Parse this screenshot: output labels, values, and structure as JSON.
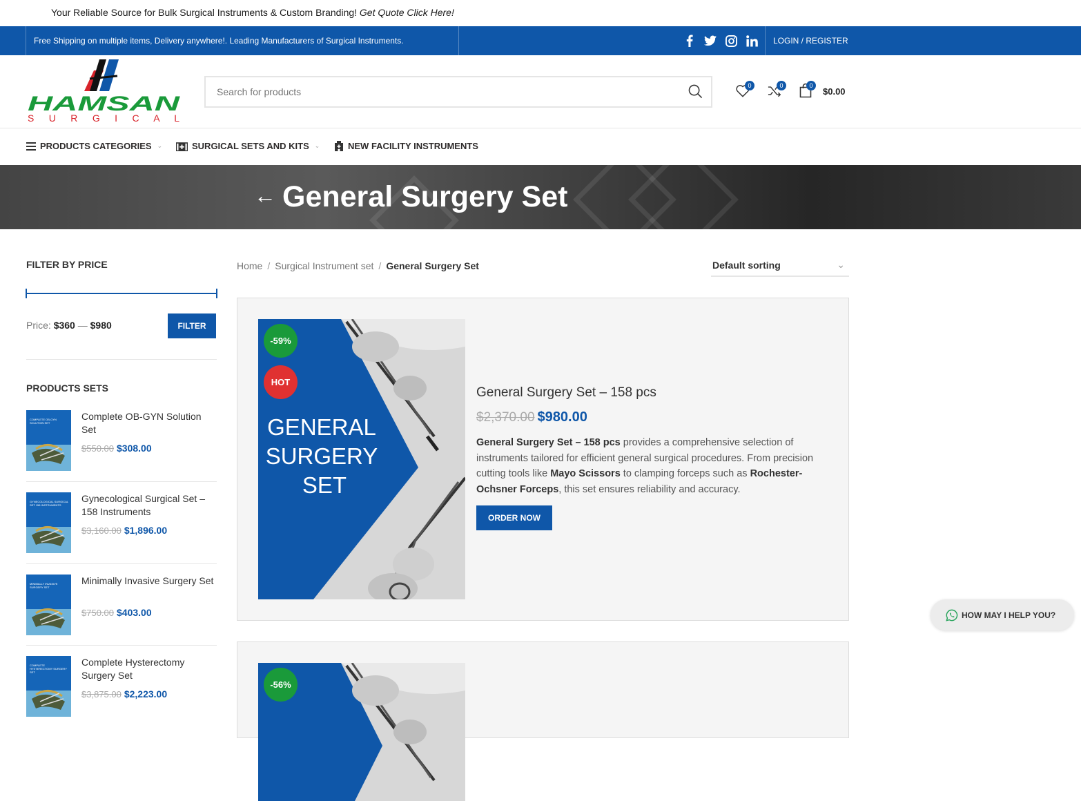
{
  "promo": {
    "text": "Your Reliable Source for Bulk Surgical Instruments & Custom Branding!",
    "link": "Get Quote Click Here!"
  },
  "topbar": {
    "message": "Free Shipping on multiple items, Delivery anywhere!. Leading Manufacturers of Surgical Instruments.",
    "login": "LOGIN / REGISTER",
    "social": [
      "facebook-icon",
      "twitter-icon",
      "instagram-icon",
      "linkedin-icon"
    ]
  },
  "logo": {
    "brand": "HAMSAN",
    "sub": "S U R G I C A L"
  },
  "search": {
    "placeholder": "Search for products"
  },
  "header": {
    "wishlist_count": "0",
    "compare_count": "0",
    "cart_count": "0",
    "cart_total": "$0.00"
  },
  "nav": {
    "categories": "PRODUCTS CATEGORIES",
    "sets": "SURGICAL SETS AND KITS",
    "facility": "NEW FACILITY INSTRUMENTS"
  },
  "hero": {
    "back": "←",
    "title": "General Surgery Set"
  },
  "sidebar": {
    "filter_title": "FILTER BY PRICE",
    "price_label": "Price:",
    "price_min": "$360",
    "dash": "—",
    "price_max": "$980",
    "filter_button": "FILTER",
    "sets_title": "PRODUCTS SETS",
    "products": [
      {
        "name": "Complete OB-GYN Solution Set",
        "old": "$550.00",
        "new": "$308.00",
        "thumb": "COMPLETE OB-GYN SOLUTION SET"
      },
      {
        "name": "Gynecological Surgical Set – 158 Instruments",
        "old": "$3,160.00",
        "new": "$1,896.00",
        "thumb": "GYNECOLOGICAL SURGICAL SET 158 INSTRUMENTS"
      },
      {
        "name": "Minimally Invasive Surgery Set",
        "old": "$750.00",
        "new": "$403.00",
        "thumb": "MINIMALLY INVASIVE SURGERY SET"
      },
      {
        "name": "Complete Hysterectomy Surgery Set",
        "old": "$3,875.00",
        "new": "$2,223.00",
        "thumb": "COMPLETE HYSTERECTOMY SURGERY SET"
      }
    ]
  },
  "breadcrumb": {
    "home": "Home",
    "sep": "/",
    "category": "Surgical Instrument set",
    "current": "General Surgery Set"
  },
  "sorting": {
    "selected": "Default sorting"
  },
  "products": [
    {
      "discount": "-59%",
      "hot": "HOT",
      "image_text": [
        "GENERAL",
        "SURGERY",
        "SET"
      ],
      "title": "General Surgery Set – 158 pcs",
      "old_price": "$2,370.00",
      "new_price": "$980.00",
      "desc_b1": "General Surgery Set – 158 pcs",
      "desc_1": " provides a comprehensive selection of instruments tailored for efficient general surgical procedures. From precision cutting tools like ",
      "desc_b2": "Mayo Scissors",
      "desc_2": " to clamping forceps such as ",
      "desc_b3": "Rochester-Ochsner Forceps",
      "desc_3": ", this set ensures reliability and accuracy.",
      "button": "ORDER NOW"
    },
    {
      "discount": "-56%"
    }
  ],
  "help": {
    "label": "HOW MAY I HELP YOU?"
  },
  "colors": {
    "brand_blue": "#0f57a9",
    "logo_green": "#1a9a3a",
    "logo_red": "#d8232a",
    "sale_green": "#1a9a3a",
    "hot_red": "#e03131"
  }
}
